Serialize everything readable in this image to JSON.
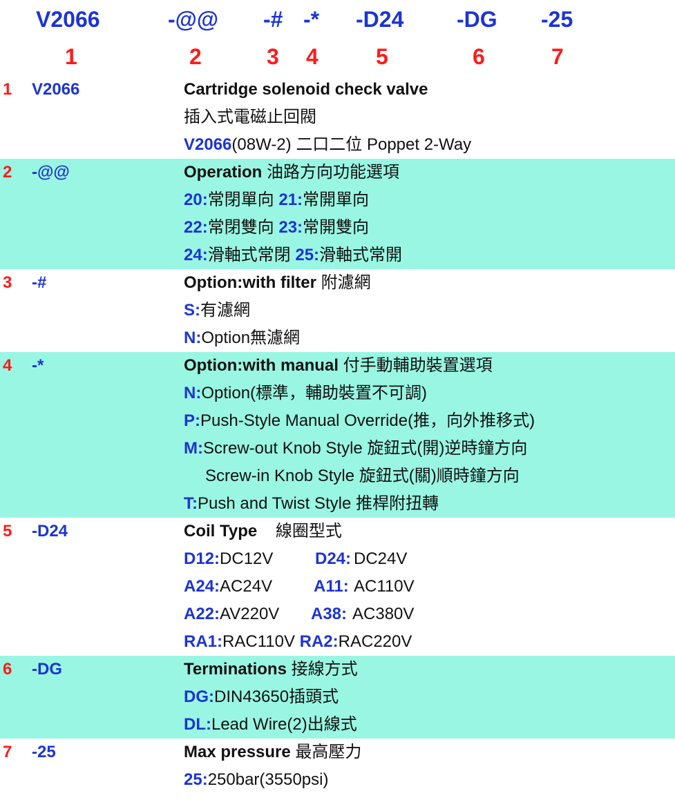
{
  "header": {
    "codes": [
      "V2066",
      "-@@",
      "-#",
      "-*",
      "-D24",
      "-DG",
      "-25"
    ],
    "numbers": [
      "1",
      "2",
      "3",
      "4",
      "5",
      "6",
      "7"
    ]
  },
  "sections": [
    {
      "num": "1",
      "code": "V2066",
      "title": "Cartridge solenoid check valve",
      "title_cn": "",
      "line1": "插入式電磁止回閥",
      "line2_key": "V2066",
      "line2_rest": "(08W-2) 二口二位 Poppet 2-Way"
    },
    {
      "num": "2",
      "code": "-@@",
      "title": "Operation",
      "title_cn": " 油路方向功能選項",
      "l1_k1": "20:",
      "l1_v1": "常閉單向 ",
      "l1_k2": "21:",
      "l1_v2": "常開單向",
      "l2_k1": "22:",
      "l2_v1": "常閉雙向 ",
      "l2_k2": "23:",
      "l2_v2": "常開雙向",
      "l3_k1": "24:",
      "l3_v1": "滑軸式常閉 ",
      "l3_k2": "25:",
      "l3_v2": "滑軸式常開"
    },
    {
      "num": "3",
      "code": "-#",
      "title": "Option:with filter",
      "title_cn": " 附濾網",
      "l1_k": "S:",
      "l1_v": "有濾網",
      "l2_k": "N:",
      "l2_v": "Option無濾網"
    },
    {
      "num": "4",
      "code": "-*",
      "title": "Option:with manual",
      "title_cn": " 付手動輔助裝置選項",
      "l1_k": "N:",
      "l1_v": "Option(標準，輔助裝置不可調)",
      "l2_k": "P:",
      "l2_v": "Push-Style Manual Override(推，向外推移式)",
      "l3_k": "M:",
      "l3_v": "Screw-out Knob Style 旋鈕式(開)逆時鐘方向",
      "l4_v": "Screw-in Knob Style 旋鈕式(關)順時鐘方向",
      "l5_k": "T:",
      "l5_v": "Push and Twist Style 推桿附扭轉"
    },
    {
      "num": "5",
      "code": "-D24",
      "title": "Coil Type",
      "title_cn": "    線圈型式",
      "l1_k1": "D12:",
      "l1_v1": "DC12V",
      "l1_k2": "D24:",
      "l1_v2": "DC24V",
      "l2_k1": "A24:",
      "l2_v1": "AC24V",
      "l2_k2": "A11:",
      "l2_v2": "AC110V",
      "l3_k1": "A22:",
      "l3_v1": "AV220V",
      "l3_k2": "A38:",
      "l3_v2": "AC380V",
      "l4_k1": "RA1:",
      "l4_v1": "RAC110V ",
      "l4_k2": "RA2:",
      "l4_v2": "RAC220V"
    },
    {
      "num": "6",
      "code": "-DG",
      "title": "Terminations",
      "title_cn": " 接線方式",
      "l1_k": "DG:",
      "l1_v": "DIN43650插頭式",
      "l2_k": "DL:",
      "l2_v": "Lead Wire(2)出線式"
    },
    {
      "num": "7",
      "code": "-25",
      "title": "Max pressure",
      "title_cn": " 最高壓力",
      "l1_k": "25:",
      "l1_v": "250bar(3550psi)"
    }
  ]
}
